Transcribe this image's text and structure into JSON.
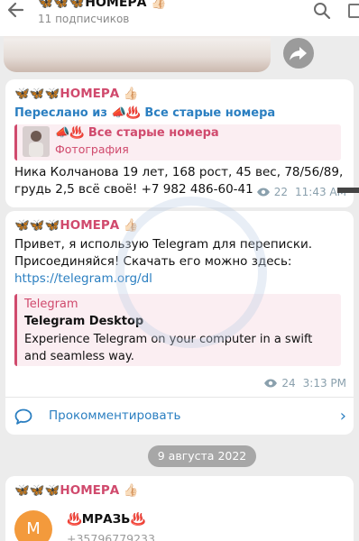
{
  "header": {
    "title": "🦋🦋🦋НОМЕРА 👍🏻",
    "subscribers": "11 подписчиков",
    "icons": [
      "back-arrow-icon",
      "search-icon",
      "more-icon"
    ]
  },
  "messages": [
    {
      "author": "🦋🦋🦋НОМЕРА 👍🏻",
      "forwarded_from_label": "Переслано из",
      "forwarded_from": "📣♨️ Все старые номера",
      "reply": {
        "title": "📣♨️ Все старые номера",
        "subtitle": "Фотография"
      },
      "text": "Ника Колчанова 19 лет, 168 рост, 45 вес, 78/56/89, грудь 2,5 всё своё! +7 982 486-60-41",
      "views": "22",
      "time": "11:43 AM"
    },
    {
      "author": "🦋🦋🦋НОМЕРА 👍🏻",
      "text": "Привет, я использую Telegram для переписки. Присоединяйся! Скачать его можно здесь:",
      "link": "https://telegram.org/dl",
      "preview": {
        "site": "Telegram",
        "title": "Telegram Desktop",
        "description": "Experience Telegram on your computer in a swift and seamless way."
      },
      "views": "24",
      "time": "3:13 PM"
    }
  ],
  "comment_label": "Прокомментировать",
  "date_separator": "9 августа 2022",
  "last_message": {
    "author": "🦋🦋🦋НОМЕРА 👍🏻",
    "avatar_letter": "M",
    "name": "♨️МРАЗЬ♨️",
    "phone": "+35796779233"
  },
  "colors": {
    "accent_link": "#2b7fc1",
    "author_pink": "#d04a6d",
    "avatar_orange": "#f39a3c",
    "date_pill": "#a7a7a7"
  }
}
